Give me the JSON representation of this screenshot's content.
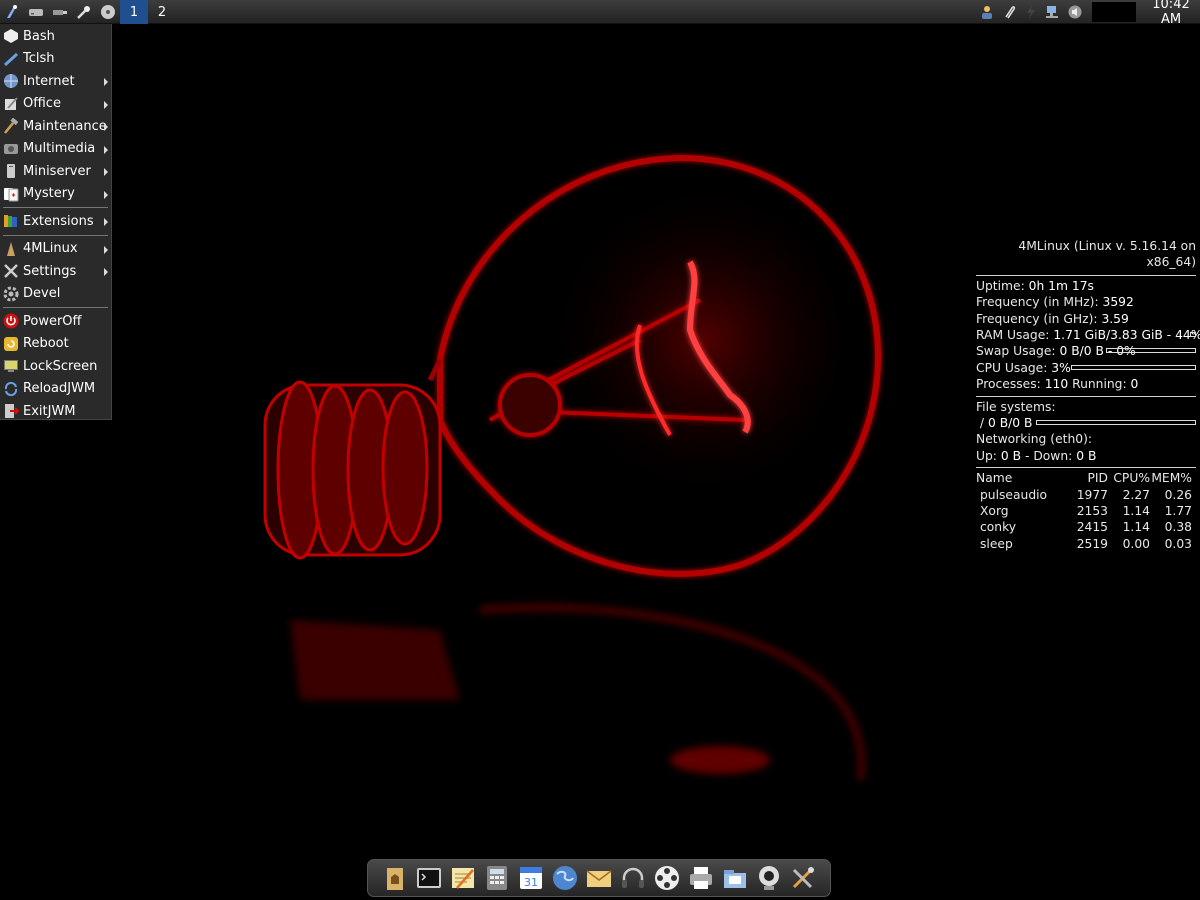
{
  "top_panel": {
    "workspaces": [
      "1",
      "2"
    ],
    "active_workspace": "1",
    "clock": "10:42 AM",
    "left_icons": [
      "jwm-menu-icon",
      "drive-icon",
      "usb-icon",
      "tools-icon",
      "cd-icon"
    ],
    "right_icons": [
      "user-icon",
      "paperclip-icon",
      "power-icon",
      "network-icon",
      "volume-icon"
    ]
  },
  "menu": {
    "items": [
      {
        "label": "Bash",
        "icon": "bash-icon",
        "submenu": false
      },
      {
        "label": "Tclsh",
        "icon": "feather-icon",
        "submenu": false
      },
      {
        "label": "Internet",
        "icon": "globe-icon",
        "submenu": true
      },
      {
        "label": "Office",
        "icon": "office-icon",
        "submenu": true
      },
      {
        "label": "Maintenance",
        "icon": "hammer-icon",
        "submenu": true
      },
      {
        "label": "Multimedia",
        "icon": "multimedia-icon",
        "submenu": true
      },
      {
        "label": "Miniserver",
        "icon": "server-icon",
        "submenu": true
      },
      {
        "label": "Mystery",
        "icon": "cards-icon",
        "submenu": true
      },
      {
        "label": "Extensions",
        "icon": "extensions-icon",
        "submenu": true
      },
      {
        "label": "4MLinux",
        "icon": "4mlinux-icon",
        "submenu": true
      },
      {
        "label": "Settings",
        "icon": "settings-icon",
        "submenu": true
      },
      {
        "label": "Devel",
        "icon": "gear-icon",
        "submenu": false
      },
      {
        "label": "PowerOff",
        "icon": "poweroff-icon",
        "submenu": false
      },
      {
        "label": "Reboot",
        "icon": "reboot-icon",
        "submenu": false
      },
      {
        "label": "LockScreen",
        "icon": "lockscreen-icon",
        "submenu": false
      },
      {
        "label": "ReloadJWM",
        "icon": "reload-icon",
        "submenu": false
      },
      {
        "label": "ExitJWM",
        "icon": "exit-icon",
        "submenu": false
      }
    ]
  },
  "conky": {
    "title": "4MLinux (Linux v. 5.16.14 on x86_64)",
    "uptime_label": "Uptime:",
    "uptime": "0h 1m 17s",
    "freq_mhz_label": "Frequency (in MHz):",
    "freq_mhz": "3592",
    "freq_ghz_label": "Frequency (in GHz):",
    "freq_ghz": "3.59",
    "ram_label": "RAM Usage:",
    "ram": "1.71 GiB/3.83 GiB - 44%",
    "ram_percent": 44,
    "swap_label": "Swap Usage:",
    "swap": "0 B/0 B - 0%",
    "swap_percent": 0,
    "cpu_label": "CPU Usage:",
    "cpu": "3%",
    "cpu_percent": 3,
    "processes_label": "Processes:",
    "processes": "110",
    "running_label": "Running:",
    "running": "0",
    "fs_label": "File systems:",
    "fs_root": "/",
    "fs_usage": "0 B/0 B",
    "fs_percent": 0,
    "net_label": "Networking (eth0):",
    "up_label": "Up:",
    "up": "0 B",
    "down_label": "- Down:",
    "down": "0 B",
    "proc_headers": [
      "Name",
      "PID",
      "CPU%",
      "MEM%"
    ],
    "procs": [
      {
        "name": "pulseaudio",
        "pid": "1977",
        "cpu": "2.27",
        "mem": "0.26"
      },
      {
        "name": "Xorg",
        "pid": "2153",
        "cpu": "1.14",
        "mem": "1.77"
      },
      {
        "name": "conky",
        "pid": "2415",
        "cpu": "1.14",
        "mem": "0.38"
      },
      {
        "name": "sleep",
        "pid": "2519",
        "cpu": "0.00",
        "mem": "0.03"
      }
    ]
  },
  "dock": {
    "icons": [
      "home-folder-icon",
      "terminal-icon",
      "text-editor-icon",
      "calculator-icon",
      "calendar-icon",
      "web-browser-icon",
      "mail-icon",
      "headphones-icon",
      "video-player-icon",
      "printer-icon",
      "file-manager-icon",
      "webcam-icon",
      "tools-icon"
    ],
    "calendar_day": "31"
  },
  "colors": {
    "bulb_glow": "#ff1a1a",
    "bulb_dark": "#7a0000",
    "active_workspace": "#1f4f8e",
    "menu_bg": "#2a2a2a"
  }
}
